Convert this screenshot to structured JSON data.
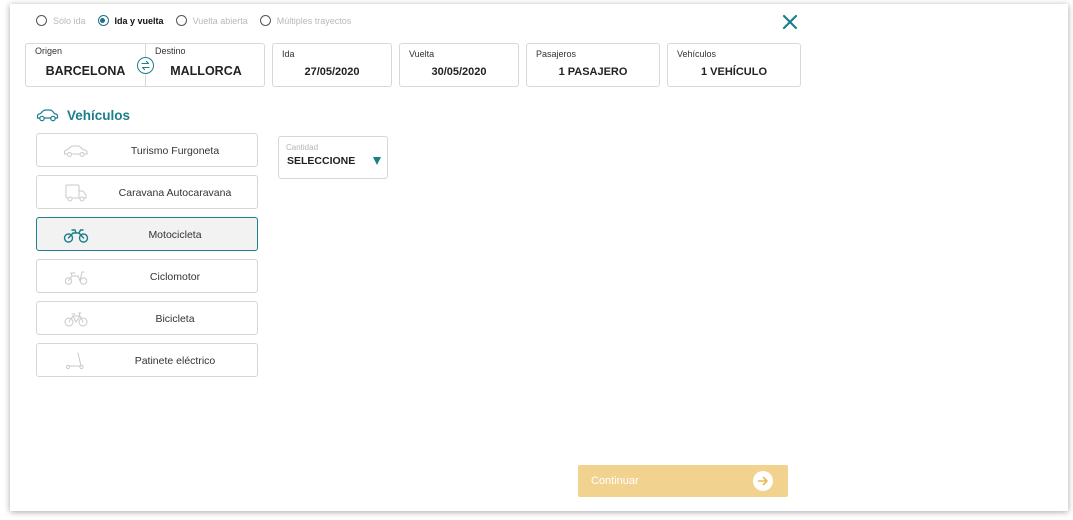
{
  "trip_types": [
    {
      "label": "Sólo ida",
      "selected": false
    },
    {
      "label": "Ida y vuelta",
      "selected": true
    },
    {
      "label": "Vuelta abierta",
      "selected": false
    },
    {
      "label": "Múltiples trayectos",
      "selected": false
    }
  ],
  "route": {
    "origin_label": "Origen",
    "origin_value": "BARCELONA",
    "destination_label": "Destino",
    "destination_value": "MALLORCA"
  },
  "fields": {
    "ida_label": "Ida",
    "ida_value": "27/05/2020",
    "vuelta_label": "Vuelta",
    "vuelta_value": "30/05/2020",
    "pasajeros_label": "Pasajeros",
    "pasajeros_value": "1 PASAJERO",
    "vehiculos_label": "Vehículos",
    "vehiculos_value": "1 VEHÍCULO"
  },
  "vehicles": {
    "title": "Vehículos",
    "items": [
      {
        "label": "Turismo Furgoneta",
        "icon": "car-icon",
        "active": false
      },
      {
        "label": "Caravana Autocaravana",
        "icon": "caravan-icon",
        "active": false
      },
      {
        "label": "Motocicleta",
        "icon": "motorcycle-icon",
        "active": true
      },
      {
        "label": "Ciclomotor",
        "icon": "moped-icon",
        "active": false
      },
      {
        "label": "Bicicleta",
        "icon": "bicycle-icon",
        "active": false
      },
      {
        "label": "Patinete eléctrico",
        "icon": "scooter-icon",
        "active": false
      }
    ]
  },
  "quantity": {
    "label": "Cantidad",
    "value": "SELECCIONE"
  },
  "continue_label": "Continuar",
  "colors": {
    "accent": "#1b7f8a",
    "continue_bg": "#f1d28f",
    "active_bg": "#f2f2f2"
  }
}
